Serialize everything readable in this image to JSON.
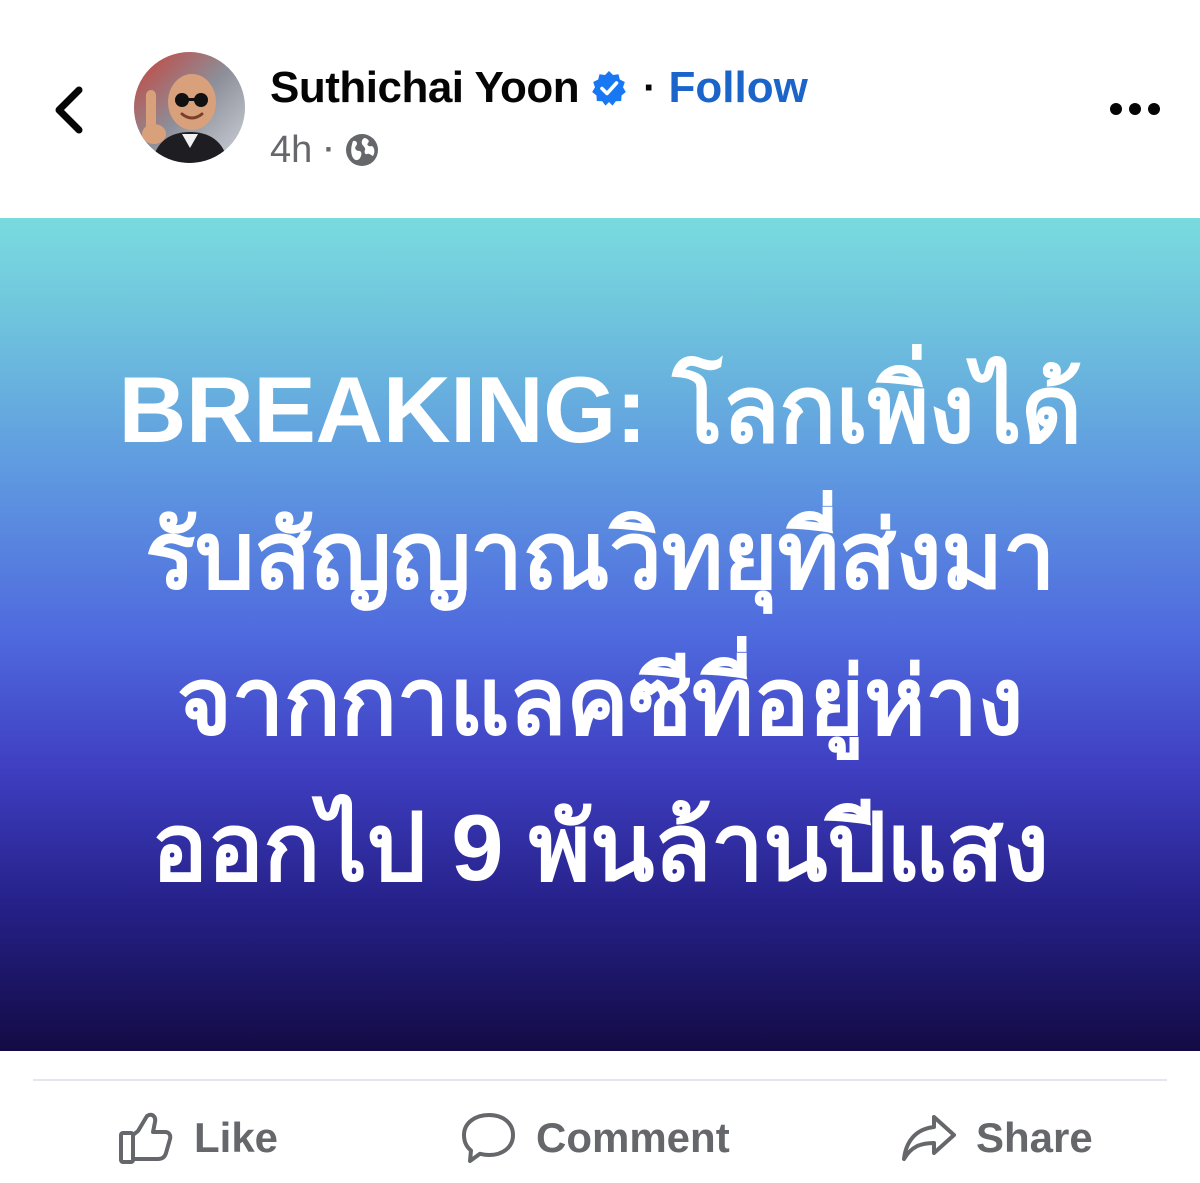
{
  "header": {
    "author_name": "Suthichai Yoon",
    "dot": "·",
    "follow_label": "Follow",
    "timestamp": "4h",
    "meta_dot": "·"
  },
  "icons": {
    "back": "chevron-left-icon",
    "verified": "verified-badge-icon",
    "privacy": "globe-icon",
    "more": "more-options-icon",
    "like": "thumbs-up-icon",
    "comment": "comment-bubble-icon",
    "share": "share-arrow-icon"
  },
  "post": {
    "lines": [
      "BREAKING: โลกเพิ่งได้",
      "รับสัญญาณวิทยุที่ส่งมา",
      "จากกาแลคซีที่อยู่ห่าง",
      "ออกไป 9 พันล้านปีแสง"
    ],
    "background_top": "#79dbde",
    "background_bottom": "#130b45",
    "text_color": "#ffffff"
  },
  "actions": {
    "like": "Like",
    "comment": "Comment",
    "share": "Share"
  },
  "colors": {
    "follow": "#1b64c9",
    "verified": "#1877f2",
    "secondary_text": "#65676b"
  }
}
